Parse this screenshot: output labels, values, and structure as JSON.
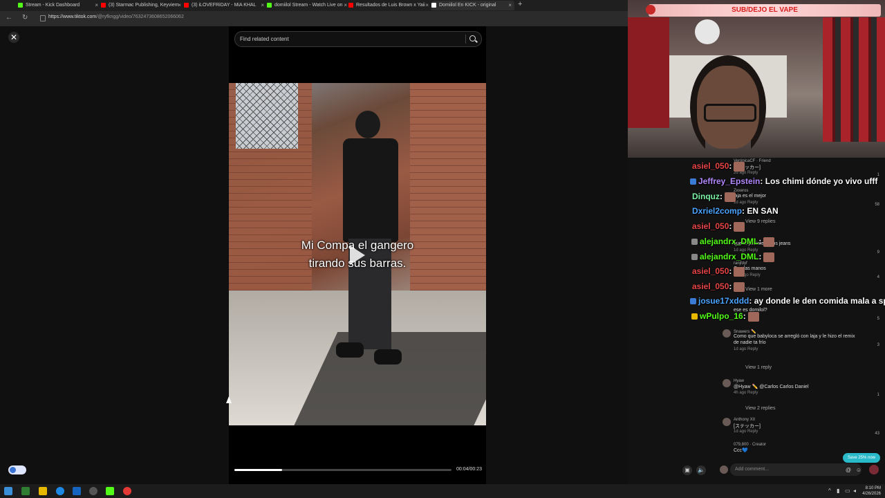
{
  "browser": {
    "tabs": [
      {
        "title": "Stream - Kick Dashboard",
        "fav_color": "#53fc18"
      },
      {
        "title": "(3) Starmac Publishing, Keyviem",
        "fav_color": "#ff0000"
      },
      {
        "title": "(3) iLOVEFRiDAY - MiA KHAL",
        "fav_color": "#ff0000"
      },
      {
        "title": "domiilol Stream - Watch Live on",
        "fav_color": "#53fc18"
      },
      {
        "title": "Resultados de Luis Brown x Yaii",
        "fav_color": "#ff0000"
      },
      {
        "title": "Domiilol En KICK - original",
        "fav_color": "#ffffff"
      }
    ],
    "url_host": "https://www.tiktok.com",
    "url_path": "/@ryfkngg/video/7632473608652066062"
  },
  "tiktok": {
    "search_placeholder": "Find related content",
    "caption_line1": "Mi Compa el gangero",
    "caption_line2": "tirando sus barras.",
    "time": "00:04/00:23",
    "progress": 0.22
  },
  "stream": {
    "banner": "SUB/DEJO EL VAPE"
  },
  "comments": [
    {
      "user": "VerónicaCF · Friend",
      "text": "[ステッカー]",
      "meta": "2d ago   Reply",
      "likes": "1"
    },
    {
      "user": "Zxxeros",
      "text": "laja es el mejor",
      "meta": "1d ago   Reply",
      "likes": "58"
    },
    {
      "user": "",
      "text": "View 9 replies",
      "meta": "",
      "likes": ""
    },
    {
      "user": "",
      "text": "que te pusistes esos jeans",
      "meta": "1d ago   Reply",
      "likes": "9"
    },
    {
      "user": "ranjfdyf",
      "text": "Con las manos",
      "meta": "21h ago   Reply",
      "likes": "4"
    },
    {
      "user": "",
      "text": "View 1 more",
      "meta": "",
      "likes": ""
    },
    {
      "user": "",
      "text": "ese es domilol?",
      "meta": "",
      "likes": "5"
    },
    {
      "user": "Snawers ✏️",
      "text": "Como que babyloca se arregló con laja y le hizo el remix",
      "text2": "de nadie ta frío",
      "meta": "1d ago   Reply",
      "likes": "3"
    },
    {
      "user": "",
      "text": "View 1 reply",
      "meta": "",
      "likes": ""
    },
    {
      "user": "Hyaw",
      "text": "@Hyaw ✏️ @Carlos  Carlos Daniel",
      "meta": "4h ago   Reply",
      "likes": "1"
    },
    {
      "user": "",
      "text": "View 2 replies",
      "meta": "",
      "likes": ""
    },
    {
      "user": "Anthony XII",
      "text": "[ステッカー]",
      "meta": "1d ago   Reply",
      "likes": "43"
    },
    {
      "user": "079,800 · Creator",
      "text": "Ccc💙",
      "meta": "",
      "likes": ""
    }
  ],
  "kick_chat": [
    {
      "user": "asiel_050",
      "color": "#e64545",
      "msg": ":",
      "badge": ""
    },
    {
      "user": "Jeffrey_Epstein",
      "color": "#b388ff",
      "msg": ": Los chimi dónde yo vivo ufff",
      "badge": "#3a7bd5"
    },
    {
      "user": "Dinquz",
      "color": "#7cf2a6",
      "msg": ":",
      "badge": ""
    },
    {
      "user": "Dxriel2comp",
      "color": "#4aa3ff",
      "msg": ": EN SAN",
      "badge": ""
    },
    {
      "user": "asiel_050",
      "color": "#e64545",
      "msg": ":",
      "badge": ""
    },
    {
      "user": "alejandrx_DML",
      "color": "#53fc18",
      "msg": ":",
      "badge": "#888"
    },
    {
      "user": "alejandrx_DML",
      "color": "#53fc18",
      "msg": ":",
      "badge": "#888"
    },
    {
      "user": "asiel_050",
      "color": "#e64545",
      "msg": ":",
      "badge": ""
    },
    {
      "user": "asiel_050",
      "color": "#e64545",
      "msg": ":",
      "badge": ""
    },
    {
      "user": "josue17xddd",
      "color": "#4aa3ff",
      "msg": ": ay donde le den comida mala a spee",
      "badge": "#3a7bd5"
    },
    {
      "user": "wPulpo_16",
      "color": "#53fc18",
      "msg": ":",
      "badge": "#e6b800"
    }
  ],
  "comment_input_placeholder": "Add comment...",
  "save_badge": "Save 25% now",
  "clock": {
    "time": "8:10 PM",
    "date": "4/26/2026"
  }
}
